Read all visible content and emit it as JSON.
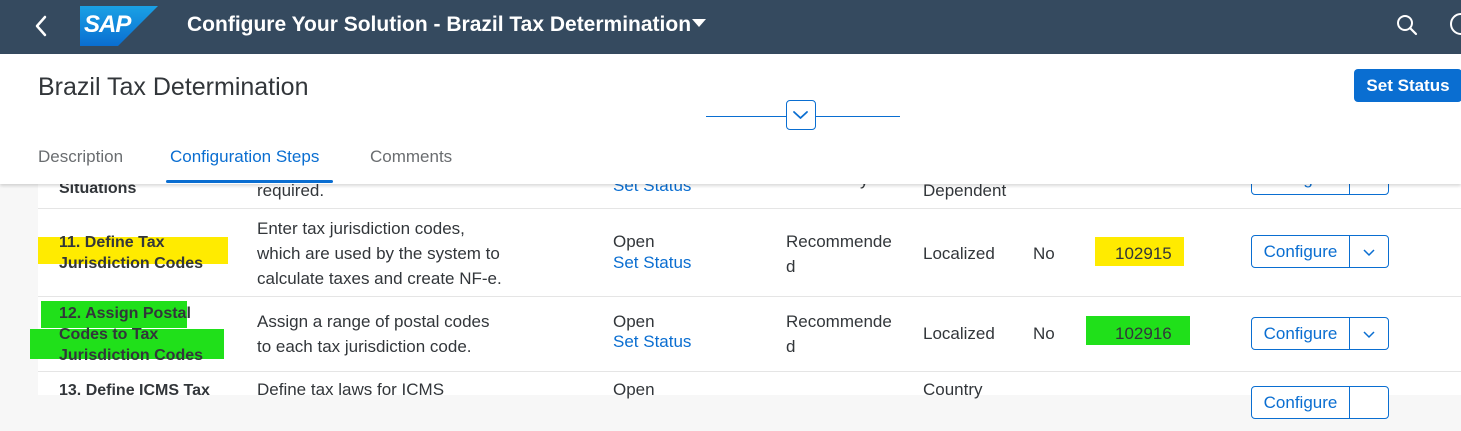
{
  "shell": {
    "title": "Configure Your Solution - Brazil Tax Determination",
    "logo_text": "SAP"
  },
  "header": {
    "page_title": "Brazil Tax Determination",
    "set_status_label": "Set Status",
    "tabs": [
      {
        "label": "Description"
      },
      {
        "label": "Configuration Steps"
      },
      {
        "label": "Comments"
      }
    ]
  },
  "rows": [
    {
      "name_lines": [
        "Situations"
      ],
      "description_lines": [
        "required."
      ],
      "status": "",
      "link": "Set Status",
      "requirement_lines": [
        "y"
      ],
      "scope": "Dependent",
      "flag": "",
      "note": "",
      "action": "Configure"
    },
    {
      "name_lines": [
        "11. Define Tax",
        "Jurisdiction Codes"
      ],
      "description_lines": [
        "Enter tax jurisdiction codes,",
        "which are used by the system to",
        "calculate taxes and create NF-e."
      ],
      "status": "Open",
      "link": "Set Status",
      "requirement_lines": [
        "Recommende",
        "d"
      ],
      "scope": "Localized",
      "flag": "No",
      "note": "102915",
      "action": "Configure"
    },
    {
      "name_lines": [
        "12. Assign Postal",
        "Codes to Tax",
        "Jurisdiction Codes"
      ],
      "description_lines": [
        "Assign a range of postal codes",
        "to each tax jurisdiction code."
      ],
      "status": "Open",
      "link": "Set Status",
      "requirement_lines": [
        "Recommende",
        "d"
      ],
      "scope": "Localized",
      "flag": "No",
      "note": "102916",
      "action": "Configure"
    },
    {
      "name_lines": [
        "13. Define ICMS Tax"
      ],
      "description_lines": [
        "Define tax laws for ICMS"
      ],
      "status": "Open",
      "link": "",
      "requirement_lines": [
        ""
      ],
      "scope": "Country",
      "flag": "",
      "note": "",
      "action": "Configure"
    }
  ],
  "colors": {
    "shell": "#354a5f",
    "accent": "#0a6ed1",
    "highlight_yellow": "#ffeb00",
    "highlight_green": "#20e01a"
  },
  "icons": {
    "back": "chevron-left-icon",
    "search": "search-icon",
    "help": "help-icon",
    "menu": "chevron-down-icon",
    "collapse": "chevron-down-icon"
  }
}
